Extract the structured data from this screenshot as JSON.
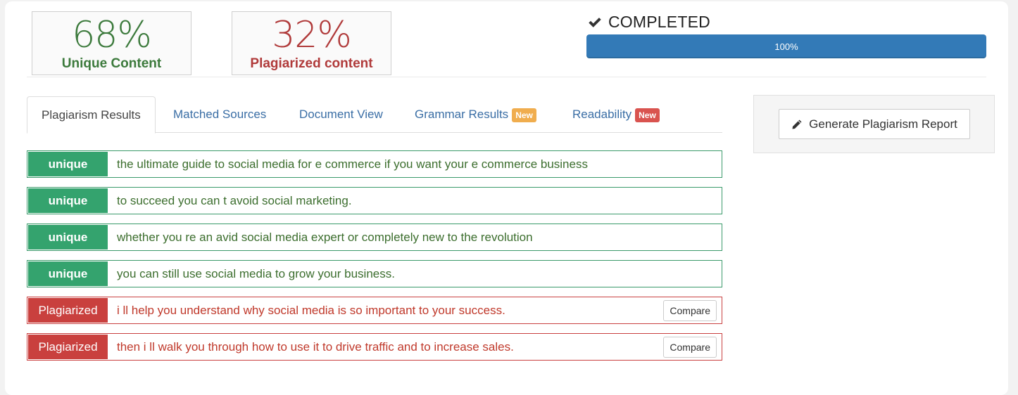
{
  "summary": {
    "unique": {
      "percent": "68%",
      "label": "Unique Content",
      "color": "#3c7a3c"
    },
    "plagiarized": {
      "percent": "32%",
      "label": "Plagiarized content",
      "color": "#b03a3a"
    }
  },
  "status": {
    "icon": "check-icon",
    "text": "COMPLETED",
    "progress_value": 100,
    "progress_label": "100%",
    "progress_color": "#337ab7"
  },
  "tabs": [
    {
      "label": "Plagiarism Results",
      "active": true
    },
    {
      "label": "Matched Sources",
      "active": false
    },
    {
      "label": "Document View",
      "active": false
    },
    {
      "label": "Grammar Results",
      "active": false,
      "badge": "New",
      "badge_color": "#f0ad4e"
    },
    {
      "label": "Readability",
      "active": false,
      "badge": "New",
      "badge_color": "#d9534f"
    }
  ],
  "report_panel": {
    "button_label": "Generate Plagiarism Report",
    "button_icon": "pencil-icon"
  },
  "results": [
    {
      "status": "unique",
      "label": "unique",
      "text": "the ultimate guide to social media for e commerce if you want your e commerce business"
    },
    {
      "status": "unique",
      "label": "unique",
      "text": "to succeed you can t avoid social marketing."
    },
    {
      "status": "unique",
      "label": "unique",
      "text": "whether you re an avid social media expert or completely new to the revolution"
    },
    {
      "status": "unique",
      "label": "unique",
      "text": "you can still use social media to grow your business."
    },
    {
      "status": "plagiarized",
      "label": "Plagiarized",
      "text": "i ll help you understand why social media is so important to your success.",
      "action": "Compare"
    },
    {
      "status": "plagiarized",
      "label": "Plagiarized",
      "text": "then i ll walk you through how to use it to drive traffic and to increase sales.",
      "action": "Compare"
    }
  ]
}
